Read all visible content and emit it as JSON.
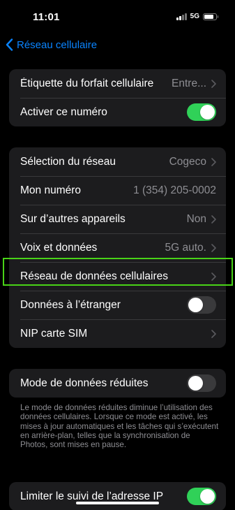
{
  "status_bar": {
    "time": "11:01",
    "network": "5G",
    "battery_level": 0.8
  },
  "nav": {
    "back_label": "Réseau cellulaire"
  },
  "group1": {
    "plan_label": "Étiquette du forfait cellulaire",
    "plan_value": "Entre...",
    "activate_label": "Activer ce numéro",
    "activate_on": true
  },
  "group2": {
    "network_selection_label": "Sélection du réseau",
    "network_selection_value": "Cogeco",
    "my_number_label": "Mon numéro",
    "my_number_value": "1 (354) 205-0002",
    "other_devices_label": "Sur d’autres appareils",
    "other_devices_value": "Non",
    "voice_data_label": "Voix et données",
    "voice_data_value": "5G auto.",
    "cellular_data_network_label": "Réseau de données cellulaires",
    "roaming_label": "Données à l’étranger",
    "roaming_on": false,
    "sim_pin_label": "NIP carte SIM"
  },
  "group3": {
    "low_data_label": "Mode de données réduites",
    "low_data_on": false,
    "low_data_footer": "Le mode de données réduites diminue l’utilisation des données cellulaires. Lorsque ce mode est activé, les mises à jour automatiques et les tâches qui s’exécutent en arrière-plan, telles que la synchronisation de Photos, sont mises en pause."
  },
  "group4": {
    "limit_ip_label": "Limiter le suivi de l’adresse IP",
    "limit_ip_on": true
  },
  "colors": {
    "accent": "#0a84ff",
    "toggle_on": "#30d158",
    "highlight": "#49d317"
  }
}
